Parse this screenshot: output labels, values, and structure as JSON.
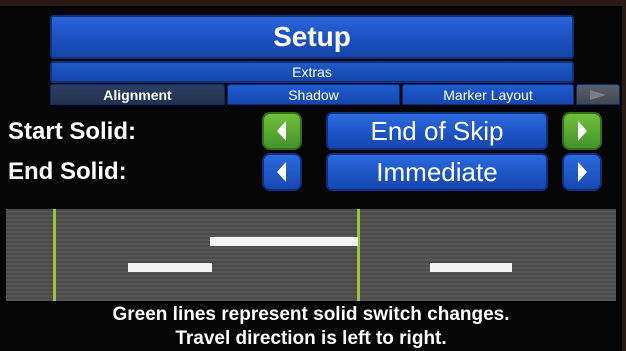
{
  "header": {
    "title": "Setup",
    "subtitle": "Extras"
  },
  "tabs": [
    {
      "label": "Alignment",
      "active": true
    },
    {
      "label": "Shadow",
      "active": false
    },
    {
      "label": "Marker Layout",
      "active": false
    }
  ],
  "rows": {
    "start_solid": {
      "label": "Start Solid:",
      "value": "End of Skip"
    },
    "end_solid": {
      "label": "End Solid:",
      "value": "Immediate"
    }
  },
  "footer": {
    "line1": "Green lines represent solid switch changes.",
    "line2": "Travel direction is left to right."
  },
  "colors": {
    "accent_blue": "#1c52c2",
    "accent_green": "#56a830",
    "switch_line": "#9ac53a"
  }
}
